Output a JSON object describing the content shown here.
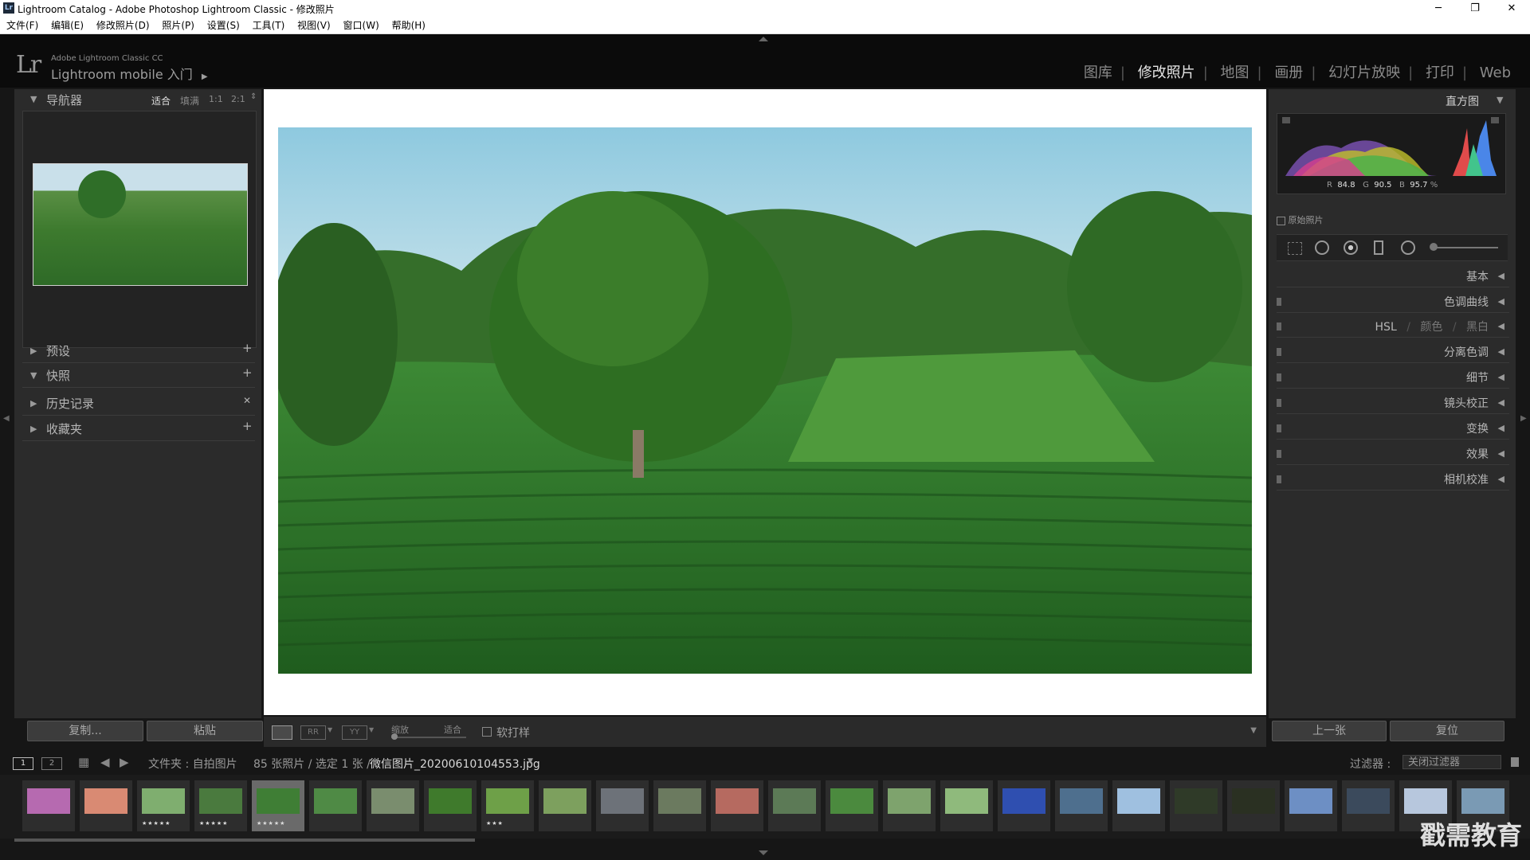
{
  "window": {
    "title": "Lightroom Catalog - Adobe Photoshop Lightroom Classic - 修改照片",
    "logo": "Lr",
    "min": "─",
    "max": "❐",
    "close": "✕"
  },
  "menu": [
    "文件(F)",
    "编辑(E)",
    "修改照片(D)",
    "照片(P)",
    "设置(S)",
    "工具(T)",
    "视图(V)",
    "窗口(W)",
    "帮助(H)"
  ],
  "identity": {
    "logo": "Lr",
    "product": "Adobe Lightroom Classic CC",
    "mobile": "Lightroom mobile 入门",
    "arrow": "▶"
  },
  "modules": [
    "图库",
    "修改照片",
    "地图",
    "画册",
    "幻灯片放映",
    "打印",
    "Web"
  ],
  "navigator": {
    "title": "导航器",
    "zoom": [
      "适合",
      "填满",
      "1:1",
      "2:1"
    ]
  },
  "left_sections": [
    {
      "label": "预设",
      "action": "+"
    },
    {
      "label": "快照",
      "action": "+"
    },
    {
      "label": "历史记录",
      "action": "✕"
    },
    {
      "label": "收藏夹",
      "action": "+"
    }
  ],
  "left_buttons": {
    "copy": "复制...",
    "paste": "粘贴"
  },
  "histogram": {
    "title": "直方图",
    "r_label": "R",
    "r": "84.8",
    "g_label": "G",
    "g": "90.5",
    "b_label": "B",
    "b": "95.7",
    "pct": "%",
    "original": "原始照片"
  },
  "right_sections": [
    "基本",
    "色调曲线",
    "分离色调",
    "细节",
    "镜头校正",
    "变换",
    "效果",
    "相机校准"
  ],
  "hsl": {
    "a": "HSL",
    "b": "颜色",
    "c": "黑白",
    "sep": "/"
  },
  "right_buttons": {
    "prev": "上一张",
    "reset": "复位"
  },
  "toolbar": {
    "zoom_label": "缩放",
    "zoom_value": "适合",
    "soft_proof": "软打样"
  },
  "filmstrip_bar": {
    "screen1": "1",
    "screen2": "2",
    "source": "文件夹 : 自拍图片",
    "count": "85 张照片 / 选定 1 张 /",
    "filename": "微信图片_20200610104553.jpg",
    "filter_label": "过滤器 :",
    "filter_value": "关闭过滤器"
  },
  "thumbnails": [
    {
      "bg": "#b66ab0",
      "stars": ""
    },
    {
      "bg": "#d98a73",
      "stars": ""
    },
    {
      "bg": "#7fae6f",
      "stars": "★★★★★"
    },
    {
      "bg": "#4a7a3e",
      "stars": "★★★★★"
    },
    {
      "bg": "#3f7e35",
      "stars": "★★★★★",
      "selected": true
    },
    {
      "bg": "#4f8a45",
      "stars": ""
    },
    {
      "bg": "#7a8d6e",
      "stars": ""
    },
    {
      "bg": "#3f7a2c",
      "stars": ""
    },
    {
      "bg": "#6ea048",
      "stars": "★★★"
    },
    {
      "bg": "#7da05e",
      "stars": ""
    },
    {
      "bg": "#6d7279",
      "stars": ""
    },
    {
      "bg": "#6b7a5f",
      "stars": ""
    },
    {
      "bg": "#b66a60",
      "stars": ""
    },
    {
      "bg": "#5c7a56",
      "stars": ""
    },
    {
      "bg": "#4b8a3e",
      "stars": ""
    },
    {
      "bg": "#7ea36d",
      "stars": ""
    },
    {
      "bg": "#8fba7c",
      "stars": ""
    },
    {
      "bg": "#2f4fb0",
      "stars": ""
    },
    {
      "bg": "#4e6f8e",
      "stars": ""
    },
    {
      "bg": "#9fc0e0",
      "stars": ""
    },
    {
      "bg": "#2f3a28",
      "stars": ""
    },
    {
      "bg": "#2a3022",
      "stars": ""
    },
    {
      "bg": "#6d8fc4",
      "stars": ""
    },
    {
      "bg": "#3b4a5c",
      "stars": ""
    },
    {
      "bg": "#b7c7dd",
      "stars": ""
    },
    {
      "bg": "#7a9ab4",
      "stars": ""
    }
  ],
  "watermark": "戳需教育",
  "colors": {
    "accent": "#e6e6e6",
    "panel": "#2b2b2b"
  }
}
